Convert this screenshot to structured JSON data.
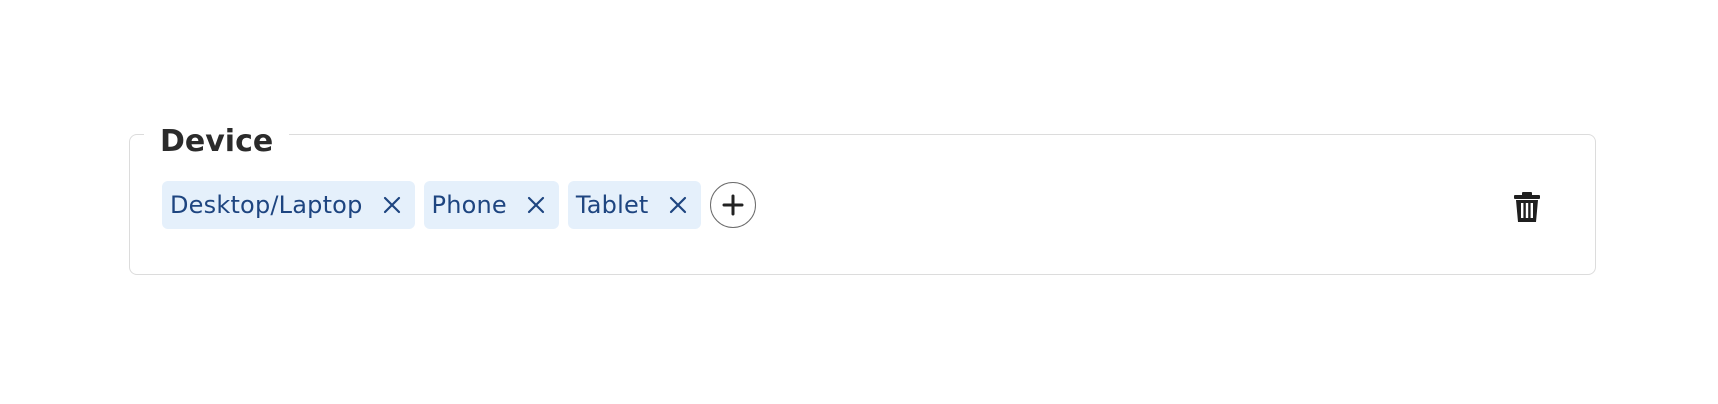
{
  "group": {
    "legend": "Device",
    "chips": [
      {
        "label": "Desktop/Laptop",
        "remove_icon": "close-icon"
      },
      {
        "label": "Phone",
        "remove_icon": "close-icon"
      },
      {
        "label": "Tablet",
        "remove_icon": "close-icon"
      }
    ],
    "add_icon": "plus-circle-icon",
    "delete_icon": "trash-icon"
  },
  "colors": {
    "chip_background": "#e5f0fb",
    "chip_text": "#1e4580",
    "border": "#dcdcdc",
    "legend_text": "#2b2b2b"
  }
}
